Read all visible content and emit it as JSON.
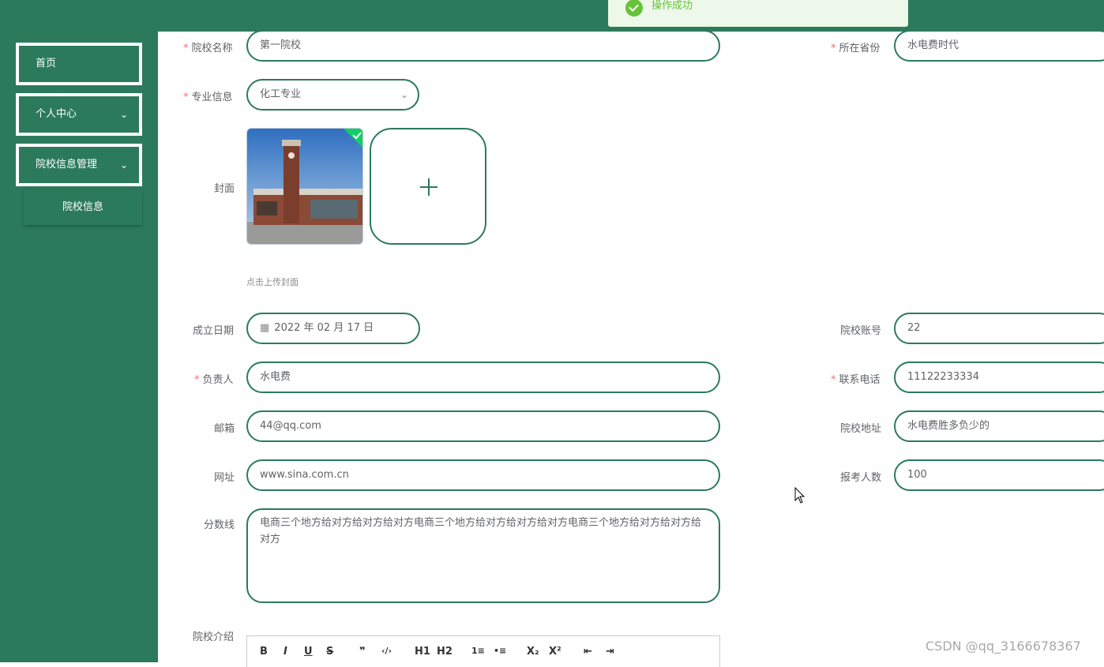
{
  "toast": {
    "message": "操作成功",
    "color": "#67c23a"
  },
  "theme": {
    "primary": "#2b7a5c",
    "required_mark": "#f56c6c"
  },
  "sidebar": {
    "items": [
      {
        "label": "首页",
        "icon": ""
      },
      {
        "label": "个人中心",
        "icon": "chevron-down-icon"
      },
      {
        "label": "院校信息管理",
        "icon": "chevron-down-icon"
      }
    ],
    "sub_items": [
      {
        "label": "院校信息"
      }
    ]
  },
  "form": {
    "school_name": {
      "label": "院校名称",
      "value": "第一院校",
      "required": true
    },
    "province": {
      "label": "所在省份",
      "value": "水电费时代",
      "required": true
    },
    "major": {
      "label": "专业信息",
      "value": "化工专业",
      "required": true
    },
    "cover": {
      "label": "封面",
      "hint": "点击上传封面"
    },
    "founded": {
      "label": "成立日期",
      "value": "2022 年 02 月 17 日"
    },
    "account": {
      "label": "院校账号",
      "value": "22"
    },
    "manager": {
      "label": "负责人",
      "value": "水电费",
      "required": true
    },
    "phone": {
      "label": "联系电话",
      "value": "11122233334",
      "required": true
    },
    "email": {
      "label": "邮箱",
      "value": "44@qq.com"
    },
    "address": {
      "label": "院校地址",
      "value": "水电费胜多负少的"
    },
    "website": {
      "label": "网址",
      "value": "www.sina.com.cn"
    },
    "applicants": {
      "label": "报考人数",
      "value": "100"
    },
    "score_line": {
      "label": "分数线",
      "value": "电商三个地方给对方给对方给对方电商三个地方给对方给对方给对方电商三个地方给对方给对方给对方"
    },
    "intro": {
      "label": "院校介绍"
    }
  },
  "editor_toolbar": [
    "B",
    "I",
    "U",
    "S",
    "❞",
    "‹/›",
    "H1",
    "H2",
    "1≡",
    "•≡",
    "X₂",
    "X²",
    "⇤",
    "⇥"
  ],
  "watermark": "CSDN @qq_3166678367"
}
